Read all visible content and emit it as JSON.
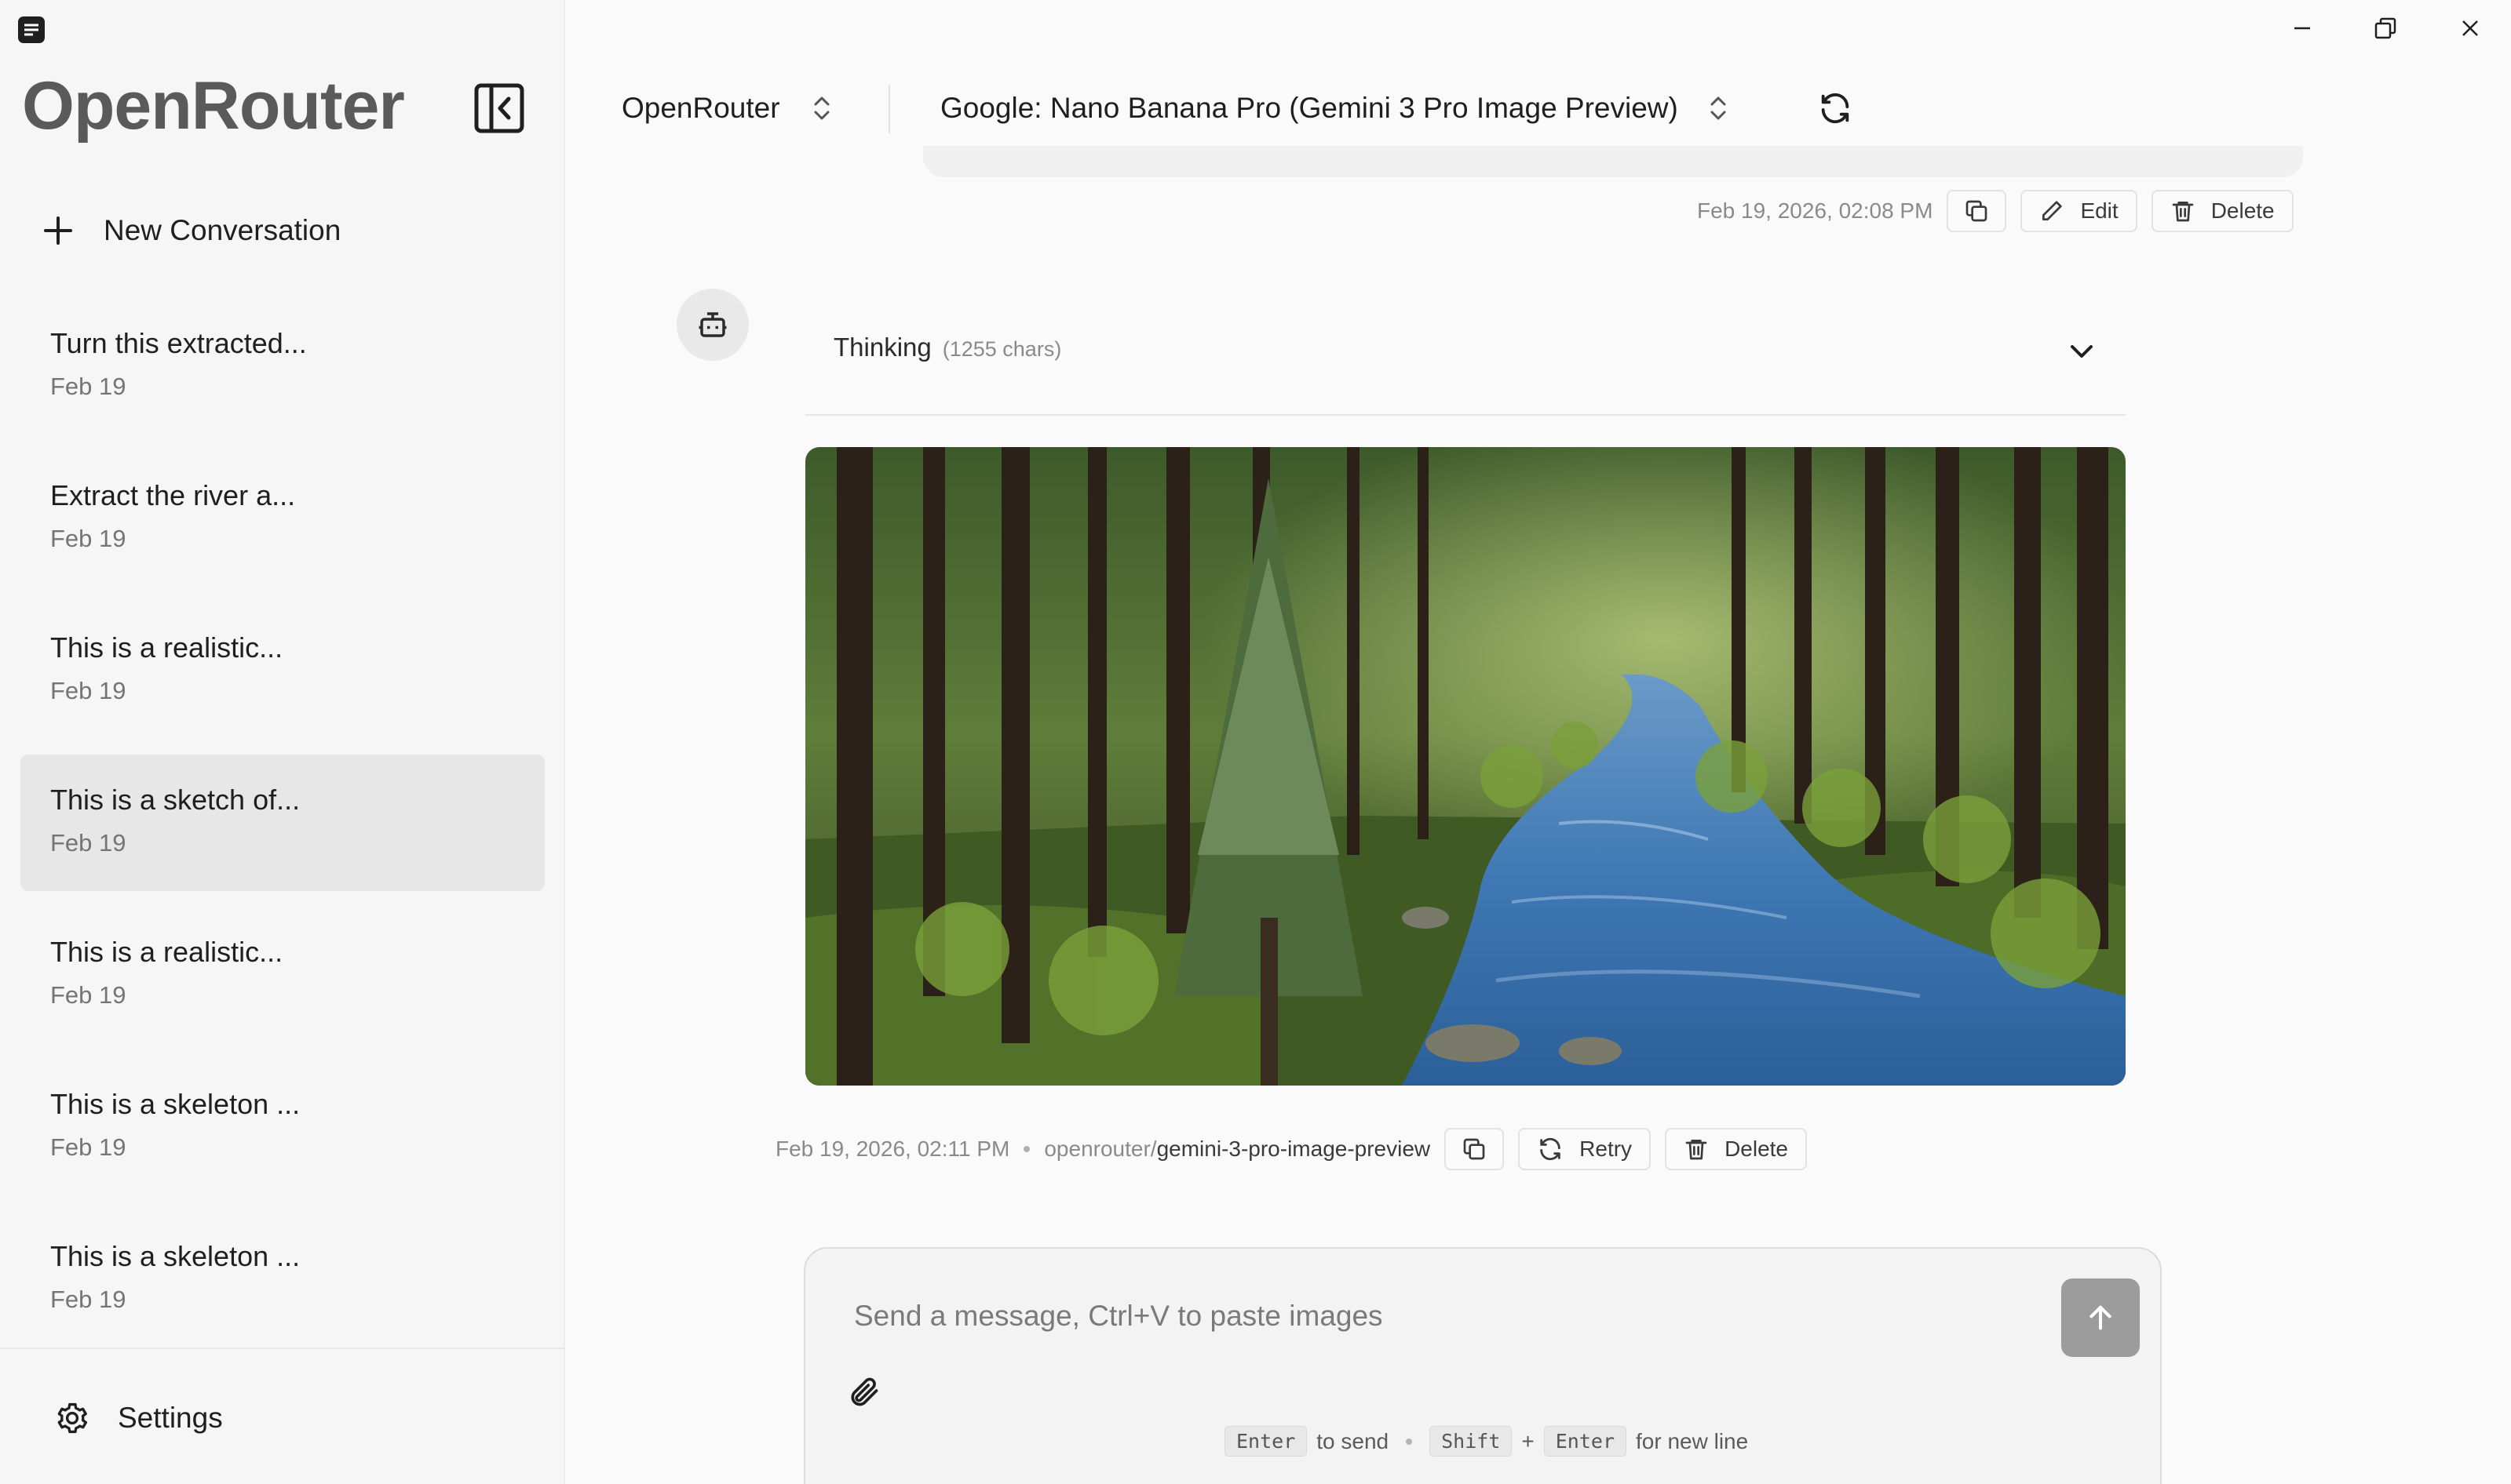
{
  "window": {
    "minimize_icon": "minimize-icon",
    "maximize_icon": "restore-icon",
    "close_icon": "close-icon"
  },
  "sidebar": {
    "brand": "OpenRouter",
    "new_conversation": "New Conversation",
    "conversations": [
      {
        "title": "Turn this extracted...",
        "date": "Feb 19",
        "active": false
      },
      {
        "title": "Extract the river a...",
        "date": "Feb 19",
        "active": false
      },
      {
        "title": "This is a realistic...",
        "date": "Feb 19",
        "active": false
      },
      {
        "title": "This is a sketch of...",
        "date": "Feb 19",
        "active": true
      },
      {
        "title": "This is a realistic...",
        "date": "Feb 19",
        "active": false
      },
      {
        "title": "This is a skeleton ...",
        "date": "Feb 19",
        "active": false
      },
      {
        "title": "This is a skeleton ...",
        "date": "Feb 19",
        "active": false
      }
    ],
    "settings": "Settings"
  },
  "header": {
    "provider": "OpenRouter",
    "model": "Google: Nano Banana Pro (Gemini 3 Pro Image Preview)"
  },
  "user_message": {
    "timestamp": "Feb 19, 2026, 02:08 PM",
    "edit_label": "Edit",
    "delete_label": "Delete"
  },
  "assistant_message": {
    "thinking_label": "Thinking",
    "thinking_count": "(1255 chars)",
    "timestamp": "Feb 19, 2026, 02:11 PM",
    "model_prefix": "openrouter/",
    "model_name": "gemini-3-pro-image-preview",
    "retry_label": "Retry",
    "delete_label": "Delete"
  },
  "composer": {
    "placeholder": "Send a message, Ctrl+V to paste images",
    "hint_key_send": "Enter",
    "hint_send_text": "to send",
    "hint_key_shift": "Shift",
    "hint_plus": "+",
    "hint_key_enter": "Enter",
    "hint_newline_text": "for new line"
  },
  "colors": {
    "accent_gray": "#9c9c9c",
    "active_item": "#e7e7e7"
  }
}
